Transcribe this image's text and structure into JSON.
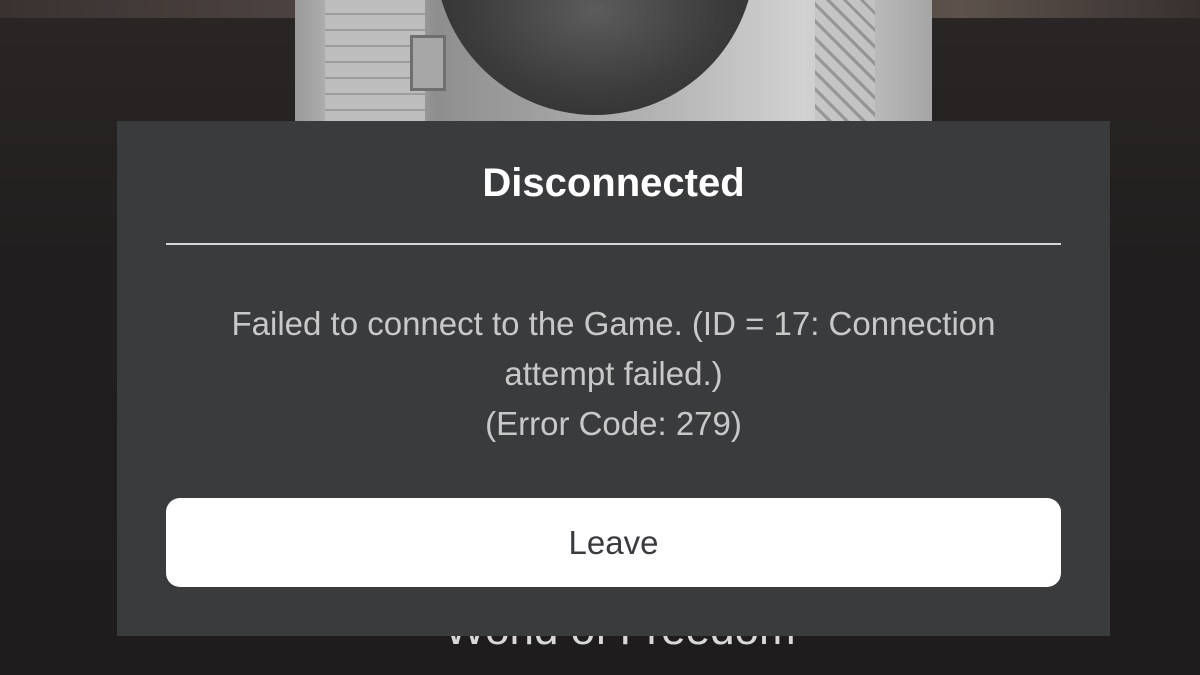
{
  "background": {
    "game_title_partial": "World of Freedom"
  },
  "dialog": {
    "title": "Disconnected",
    "message_lines": [
      "Failed to connect to the Game. (ID = 17: Connection",
      "attempt failed.)",
      "(Error Code: 279)"
    ],
    "leave_label": "Leave"
  },
  "colors": {
    "modal_background": "#393b3d",
    "title_text": "#ffffff",
    "message_text": "#c8c8c8",
    "button_background": "#ffffff",
    "button_text": "#393b3d"
  }
}
